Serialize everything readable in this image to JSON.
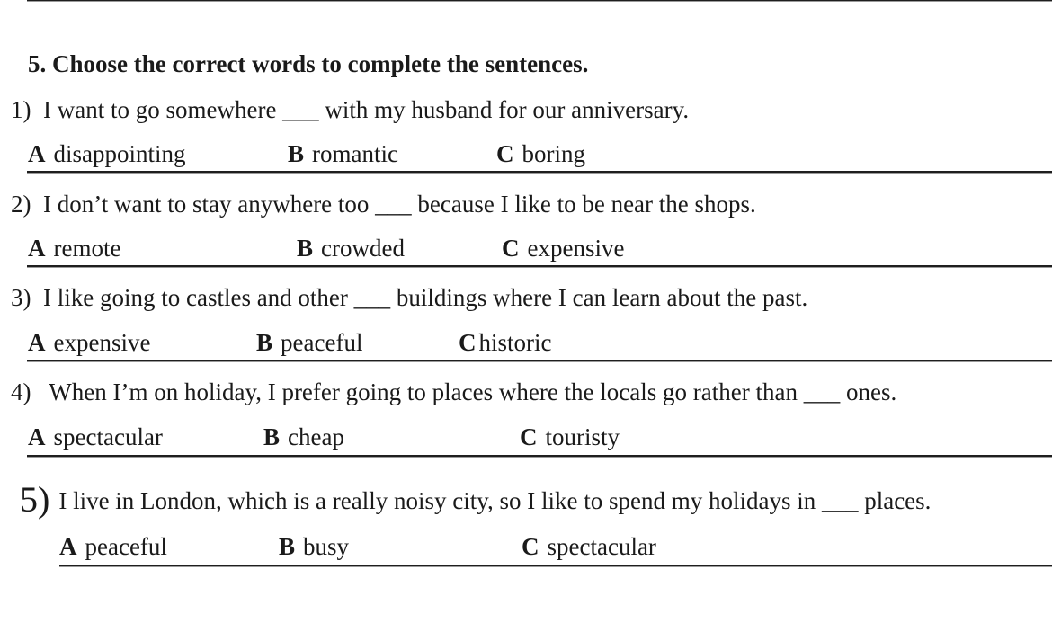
{
  "exercise": {
    "title": "5. Choose the correct words to complete the sentences."
  },
  "questions": [
    {
      "number": "1)",
      "text": "I want to go somewhere ___ with my husband for our anniversary.",
      "options": [
        {
          "letter": "A",
          "word": "disappointing"
        },
        {
          "letter": "B",
          "word": "romantic"
        },
        {
          "letter": "C",
          "word": "boring"
        }
      ]
    },
    {
      "number": "2)",
      "text": "I don’t want to stay anywhere too ___ because I like to be near the shops.",
      "options": [
        {
          "letter": "A",
          "word": "remote"
        },
        {
          "letter": "B",
          "word": "crowded"
        },
        {
          "letter": "C",
          "word": "expensive"
        }
      ]
    },
    {
      "number": "3)",
      "text": "I like going to castles and other ___ buildings where I can learn about the past.",
      "options": [
        {
          "letter": "A",
          "word": "expensive"
        },
        {
          "letter": "B",
          "word": "peaceful"
        },
        {
          "letter": "C",
          "word": "historic"
        }
      ]
    },
    {
      "number": "4)",
      "text": "When I’m on holiday, I prefer going to places where the locals go rather than ___ ones.",
      "options": [
        {
          "letter": "A",
          "word": "spectacular"
        },
        {
          "letter": "B",
          "word": "cheap"
        },
        {
          "letter": "C",
          "word": "touristy"
        }
      ]
    },
    {
      "number": "5)",
      "text": "I live in London, which is a really noisy city, so I like to spend my holidays in ___ places.",
      "options": [
        {
          "letter": "A",
          "word": "peaceful"
        },
        {
          "letter": "B",
          "word": "busy"
        },
        {
          "letter": "C",
          "word": "spectacular"
        }
      ]
    }
  ]
}
